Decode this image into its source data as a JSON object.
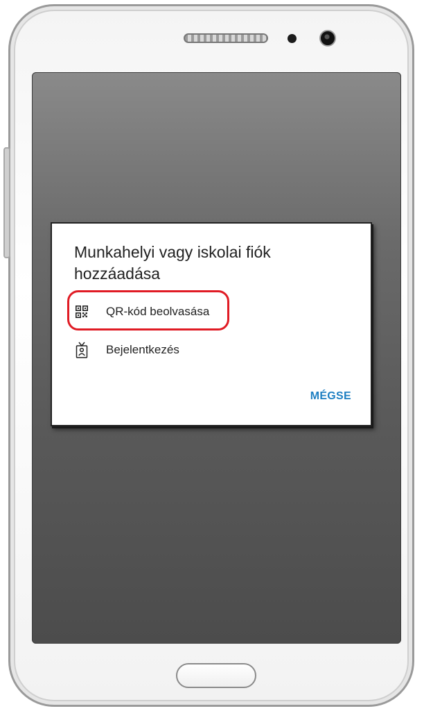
{
  "dialog": {
    "title": "Munkahelyi vagy iskolai fiók hozzáadása",
    "options": [
      {
        "label": "QR-kód beolvasása",
        "icon": "qr-code-icon",
        "highlighted": true
      },
      {
        "label": "Bejelentkezés",
        "icon": "id-badge-icon",
        "highlighted": false
      }
    ],
    "cancel_label": "MÉGSE"
  },
  "colors": {
    "accent": "#1e7fc2",
    "highlight": "#e01b24",
    "text": "#212121",
    "scrim": "#5a5a5a"
  }
}
